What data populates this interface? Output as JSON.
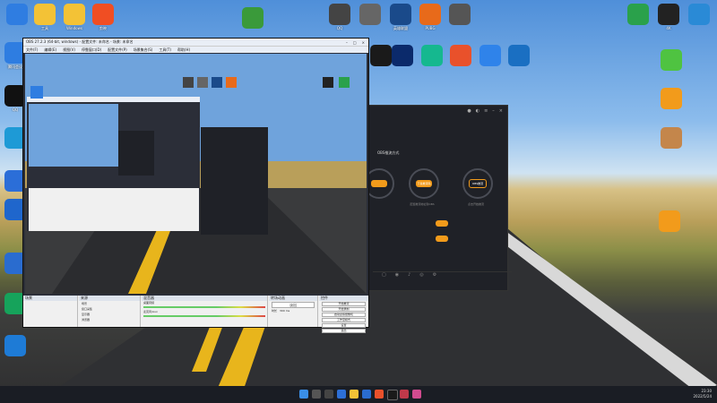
{
  "desktop": {
    "top_icons": [
      {
        "label": "",
        "color": "#2f7de1"
      },
      {
        "label": "工具",
        "color": "#f3c236"
      },
      {
        "label": "Windows",
        "color": "#f3c236"
      },
      {
        "label": "剪映",
        "color": "#f04e23"
      },
      {
        "label": "",
        "color": "#3a9a3a"
      },
      {
        "label": "QQ",
        "color": "#444"
      },
      {
        "label": "",
        "color": "#666"
      },
      {
        "label": "英雄联盟",
        "color": "#1a4a8a"
      },
      {
        "label": "PUBG",
        "color": "#e86a1a"
      },
      {
        "label": "",
        "color": "#555"
      }
    ],
    "right_icons": [
      {
        "label": "",
        "color": "#2aa14b"
      },
      {
        "label": "4K",
        "color": "#222"
      },
      {
        "label": "",
        "color": "#2a8ad6"
      }
    ],
    "left_icons": [
      {
        "label": "腾讯会议",
        "color": "#2e7de1"
      },
      {
        "label": "QQ",
        "color": "#111"
      },
      {
        "label": "",
        "color": "#1e9ad6"
      },
      {
        "label": "",
        "color": "#2b6ed8"
      },
      {
        "label": "",
        "color": "#1f66cc"
      },
      {
        "label": "",
        "color": "#2a6ccf"
      },
      {
        "label": "",
        "color": "#16a35b"
      },
      {
        "label": "",
        "color": "#1e7bd6"
      }
    ],
    "mid_icons": [
      {
        "label": "",
        "color": "#1a1a1a"
      },
      {
        "label": "",
        "color": "#0b2a6b"
      },
      {
        "label": "",
        "color": "#15b88f"
      },
      {
        "label": "",
        "color": "#e9512b"
      },
      {
        "label": "",
        "color": "#2f83ea"
      },
      {
        "label": "",
        "color": "#1a6fc2"
      }
    ],
    "side_icons": [
      {
        "label": "",
        "color": "#4fc341"
      },
      {
        "label": "",
        "color": "#f29b1b"
      },
      {
        "label": "",
        "color": "#c4864b"
      },
      {
        "label": "",
        "color": "#f29b1b"
      }
    ]
  },
  "obs": {
    "title": "OBS 27.2.3 (64-bit, windows) - 配置文件: 未命名 - 场景: 未命名",
    "menu": [
      "文件(F)",
      "编辑(E)",
      "视图(V)",
      "停靠窗口(D)",
      "配置文件(P)",
      "场景集合(S)",
      "工具(T)",
      "帮助(H)"
    ],
    "panels": {
      "scenes": "场景",
      "sources": "来源",
      "mixer": "混音器",
      "transitions": "转场动画",
      "controls": "控件"
    },
    "sources_items": [
      "场景",
      "窗口采集",
      "显示器",
      "浏览器"
    ],
    "mixer_tracks": [
      "桌面音频",
      "麦克风/Aux"
    ],
    "transition_value": "淡出",
    "duration_label": "时长",
    "duration_value": "300 ms",
    "controls": [
      "开始推流",
      "开始录制",
      "启动虚拟摄像机",
      "工作室模式",
      "设置",
      "退出"
    ],
    "status": "LIVE: 00:00:00   REC: 00:00:00   CPU: 0.6%, 30.00 fps"
  },
  "dark_app": {
    "mode_title": "OBS推流方式",
    "badge": "",
    "steps": [
      "开播设置",
      "下载推流码",
      "OBS推流"
    ],
    "step_labels": [
      "",
      "配置推流地址到OBS",
      "点击开始推流"
    ]
  },
  "taskbar": {
    "time": "23:30",
    "date": "2022/5/24"
  }
}
